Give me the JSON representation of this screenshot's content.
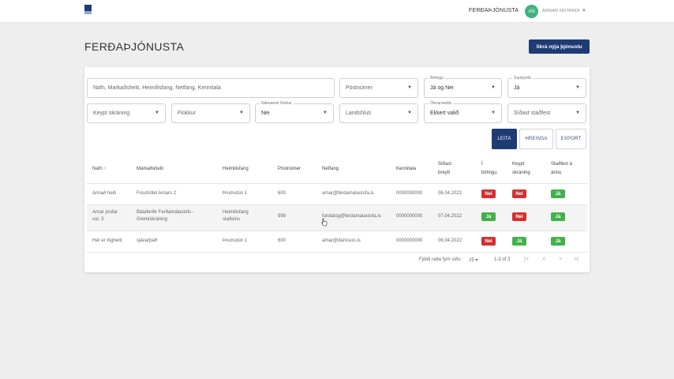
{
  "header": {
    "nav_link": "FERÐAÞJÓNUSTA",
    "avatar_initials": "AN",
    "user_name": "ARNAR NOTANDI"
  },
  "page": {
    "title": "FERÐAÞJÓNUSTA",
    "add_button": "Skrá nýja þjónustu"
  },
  "filters": {
    "search_placeholder": "Nafn, Markaðsheiti, Heimilisfang, Netfang, Kennitala",
    "postal_placeholder": "Póstnúmer",
    "published_label": "Birtingu",
    "published_value": "Já og Nei",
    "confirmed_label": "Samþykkt",
    "confirmed_value": "Já",
    "bought_placeholder": "Keypt skráning",
    "category_placeholder": "Flokkur",
    "subcategory_label": "Nákvæmir flokkar",
    "subcategory_value": "Nei",
    "region_placeholder": "Landshluti",
    "status_label": "Ölerarstaðle",
    "status_value": "Ekkert valið",
    "last_confirmed_placeholder": "Síðast staðfest"
  },
  "actions": {
    "search": "LEITA",
    "clear": "HREINSA",
    "export": "EXPORT"
  },
  "table": {
    "headers": {
      "name": "Nafn",
      "sort_icon": "↑",
      "brand": "Markaðsheiti",
      "address": "Heimilisfang",
      "postal": "Póstnúmer",
      "email": "Netfang",
      "ssn": "Kennitala",
      "updated_1": "Síðast",
      "updated_2": "breytt",
      "published_1": "Í",
      "published_2": "birtingu",
      "bought_1": "Keypt",
      "bought_2": "skráning",
      "confirmed_1": "Staðfest á",
      "confirmed_2": "árinu"
    },
    "rows": [
      {
        "name_1": "Annað heiti",
        "name_2": "",
        "brand_1": "Fosshótel Arnars 2",
        "brand_2": "",
        "address_1": "Þrumutún 1",
        "address_2": "",
        "postal": "600",
        "email": "arnar@ferdamalastofa.is",
        "ssn": "0000000000",
        "updated": "06.04.2022",
        "published": "Nei",
        "bought": "Nei",
        "confirmed": "Já"
      },
      {
        "name_1": "Arnar prufar",
        "name_2": "vol. 3",
        "brand_1": "Bátaferðir Ferðamálastofu -",
        "brand_2": "Gremiskráning",
        "address_1": "Heimilisfang",
        "address_2": "staðsins",
        "postal": "999",
        "email": "fundalog@ferdamalastofa.is",
        "ssn": "0000000000",
        "updated": "07.04.2022",
        "published": "Já",
        "bought": "Nei",
        "confirmed": "Já"
      },
      {
        "name_1": "Hér er lögheiti",
        "name_2": "",
        "brand_1": "sjávarþað",
        "brand_2": "",
        "address_1": "Þrumutún 1",
        "address_2": "",
        "postal": "600",
        "email": "arnar@dansson.is",
        "ssn": "0000000000",
        "updated": "06.04.2022",
        "published": "Nei",
        "bought": "Já",
        "confirmed": "Já"
      }
    ]
  },
  "pagination": {
    "rows_per_page_label": "Fjöldi raða fyrir síðu",
    "rows_per_page_value": "25",
    "range": "1-3 of 3",
    "icons": [
      "first-page-icon",
      "previous-page-icon",
      "next-page-icon",
      "last-page-icon"
    ]
  },
  "colors": {
    "primary": "#1f3b74",
    "avatar": "#3fb27f",
    "badge_yes": "#43b14a",
    "badge_no": "#d32f2f"
  }
}
